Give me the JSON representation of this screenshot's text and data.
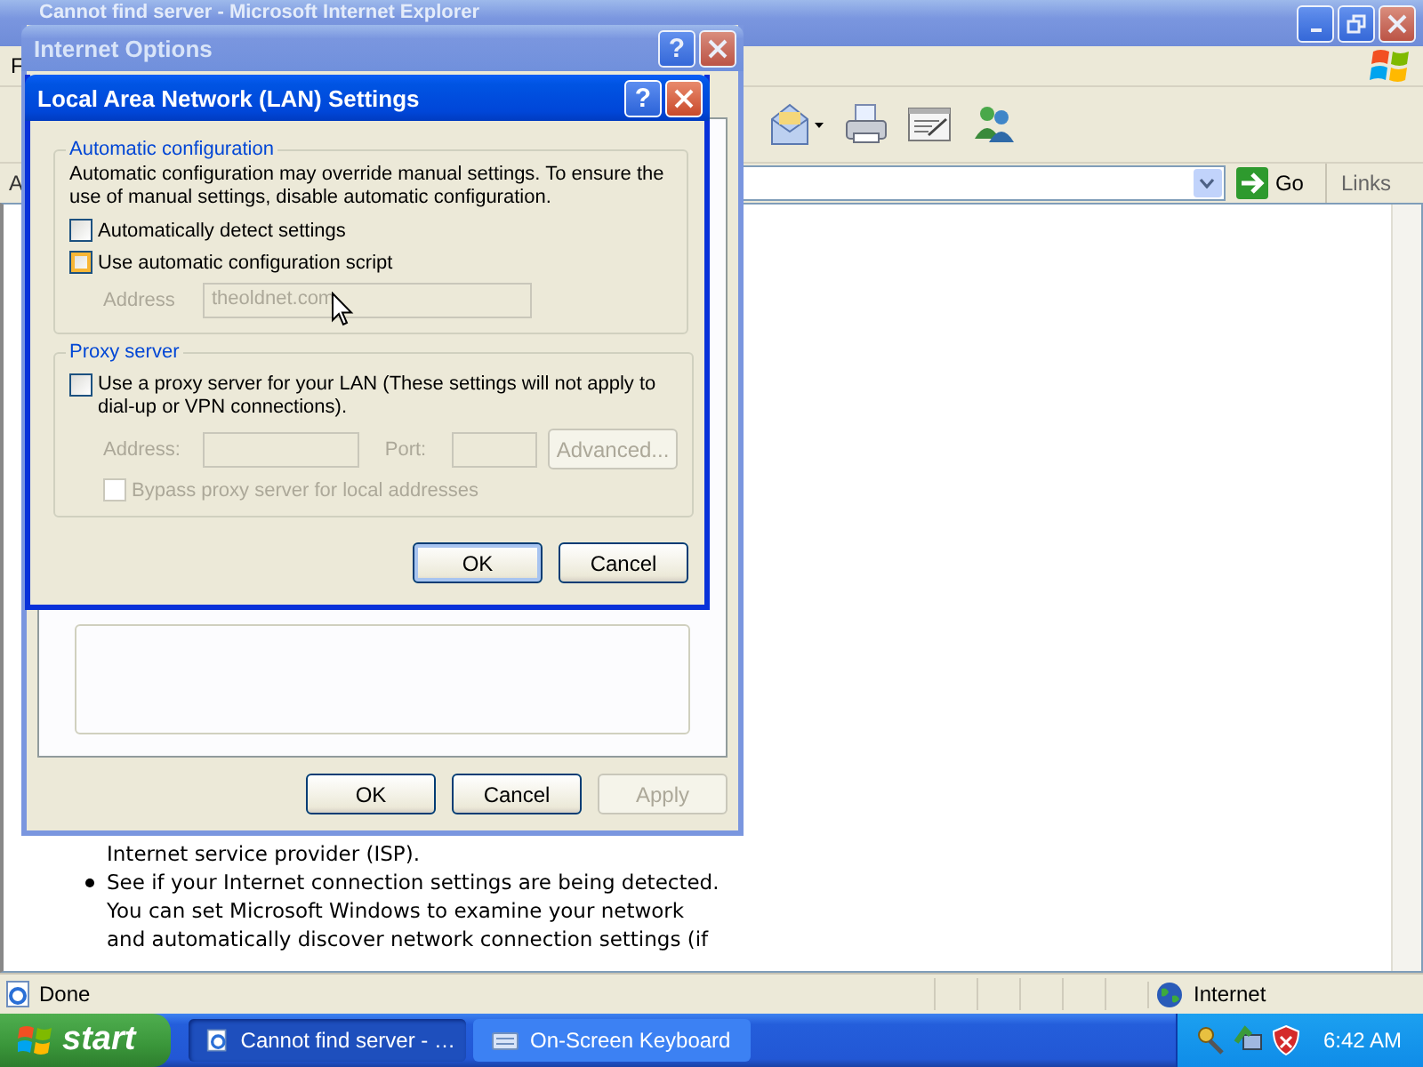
{
  "browser": {
    "title": "Cannot find server - Microsoft Internet Explorer",
    "menu_letter": "F",
    "address_letter": "A",
    "go": "Go",
    "links": "Links",
    "page": {
      "lines": [
        "Internet service provider (ISP)."
      ],
      "bullets": [
        {
          "lines": [
            "See if your Internet connection settings are being detected.",
            "You can set Microsoft Windows to examine your network",
            "and automatically discover network connection settings (if"
          ]
        }
      ]
    },
    "status_bar": {
      "text": "Done",
      "zone": "Internet"
    }
  },
  "internet_options": {
    "title": "Internet Options",
    "help": "?",
    "buttons": [
      {
        "label": "OK",
        "disabled": false
      },
      {
        "label": "Cancel",
        "disabled": false
      },
      {
        "label": "Apply",
        "disabled": true
      }
    ]
  },
  "lan_dialog": {
    "title": "Local Area Network (LAN) Settings",
    "help": "?",
    "auto_config": {
      "legend": "Automatic configuration",
      "description": "Automatic configuration may override manual settings.  To ensure the use of manual settings, disable automatic configuration.",
      "options": [
        {
          "label": "Automatically detect settings",
          "checked": false,
          "hovered": false
        },
        {
          "label": "Use automatic configuration script",
          "checked": false,
          "hovered": true
        }
      ],
      "address": {
        "label": "Address",
        "value": "theoldnet.com",
        "disabled": true
      }
    },
    "proxy": {
      "legend": "Proxy server",
      "option": {
        "label": "Use a proxy server for your LAN (These settings will not apply to dial-up or VPN connections).",
        "checked": false
      },
      "address_label": "Address:",
      "port_label": "Port:",
      "advanced": "Advanced...",
      "disabled": true,
      "bypass": {
        "label": "Bypass proxy server for local addresses",
        "checked": false
      }
    },
    "buttons": [
      {
        "label": "OK",
        "default": true
      },
      {
        "label": "Cancel",
        "default": false
      }
    ]
  },
  "taskbar": {
    "start": "start",
    "tasks": [
      {
        "label": "Cannot find server - …",
        "selected": true,
        "kind": "browser"
      },
      {
        "label": "On-Screen Keyboard",
        "selected": false,
        "kind": "keyboard"
      }
    ],
    "clock": "6:42 AM"
  }
}
